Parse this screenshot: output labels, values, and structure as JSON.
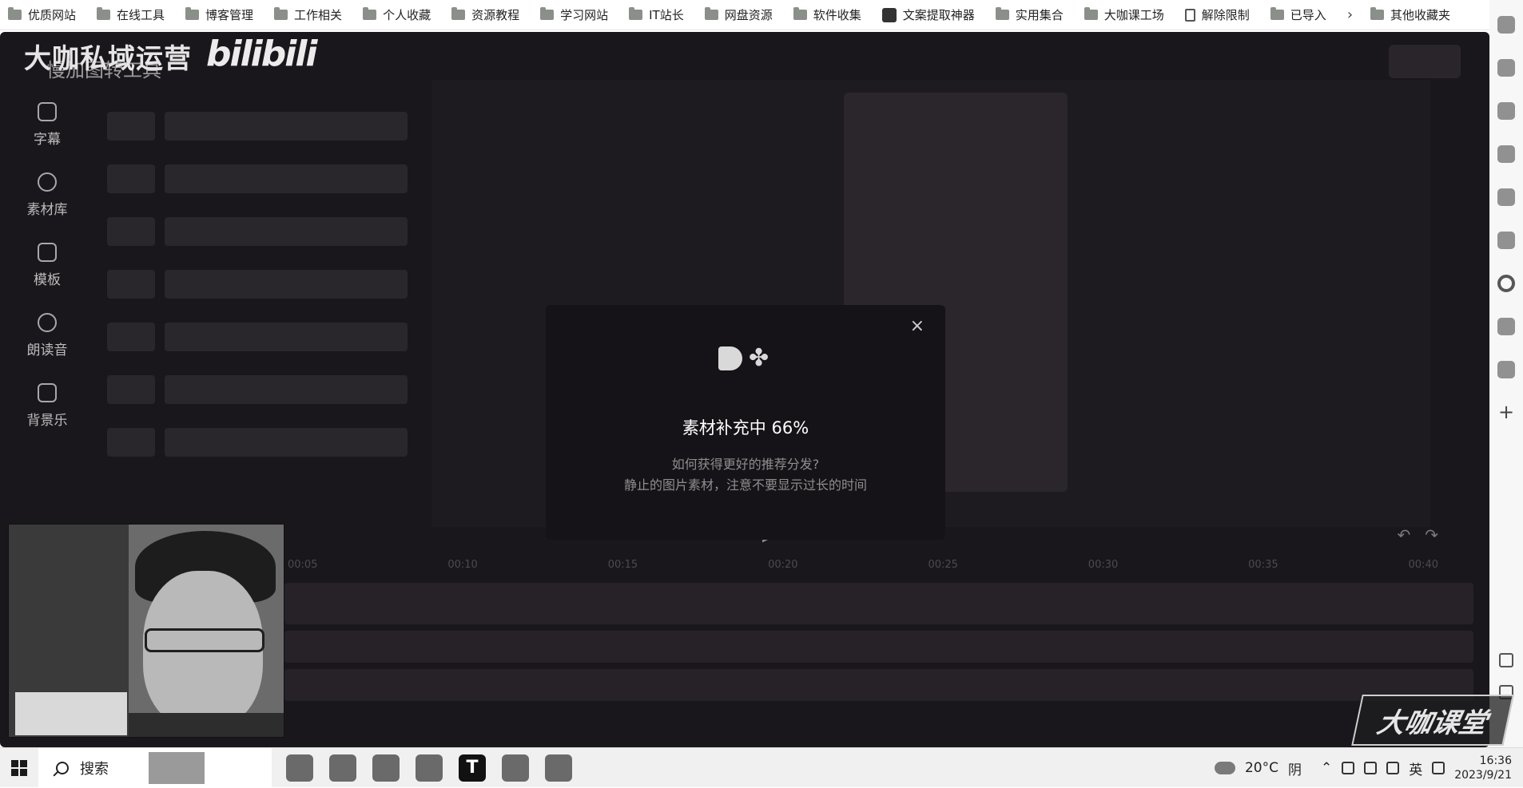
{
  "bookmarks": [
    {
      "label": "优质网站",
      "icon": "folder-icon"
    },
    {
      "label": "在线工具",
      "icon": "folder-icon"
    },
    {
      "label": "博客管理",
      "icon": "folder-icon"
    },
    {
      "label": "工作相关",
      "icon": "folder-icon"
    },
    {
      "label": "个人收藏",
      "icon": "folder-icon"
    },
    {
      "label": "资源教程",
      "icon": "folder-icon"
    },
    {
      "label": "学习网站",
      "icon": "folder-icon"
    },
    {
      "label": "IT站长",
      "icon": "folder-icon"
    },
    {
      "label": "网盘资源",
      "icon": "folder-icon"
    },
    {
      "label": "软件收集",
      "icon": "folder-icon"
    },
    {
      "label": "文案提取神器",
      "icon": "app-icon"
    },
    {
      "label": "实用集合",
      "icon": "folder-icon"
    },
    {
      "label": "大咖课工场",
      "icon": "folder-icon"
    },
    {
      "label": "解除限制",
      "icon": "document-icon"
    },
    {
      "label": "已导入",
      "icon": "folder-icon"
    }
  ],
  "bookmarks_more": "›",
  "bookmarks_other": "其他收藏夹",
  "app": {
    "brand_overlay": "大咖私域运营",
    "subtitle": "慢加图转工具",
    "bili_logo": "bilibili",
    "nav": [
      {
        "label": "字幕",
        "icon": "subtitle-icon"
      },
      {
        "label": "素材库",
        "icon": "layers-icon"
      },
      {
        "label": "模板",
        "icon": "template-icon"
      },
      {
        "label": "朗读音",
        "icon": "voice-icon"
      },
      {
        "label": "背景乐",
        "icon": "music-icon"
      }
    ],
    "player": {
      "prev": "⏮",
      "play": "▶",
      "next": "⏭",
      "undo": "↶",
      "redo": "↷"
    },
    "timeline_ticks": [
      "00:05",
      "00:10",
      "00:15",
      "00:20",
      "00:25",
      "00:30",
      "00:35",
      "00:40"
    ]
  },
  "modal": {
    "close": "×",
    "title": "素材补充中 66%",
    "progress_percent": 66,
    "hint_question": "如何获得更好的推荐分发?",
    "hint_answer": "静止的图片素材，注意不要显示过长的时间"
  },
  "watermark": "大咖课堂",
  "taskbar": {
    "search_label": "搜索",
    "apps": [
      {
        "name": "edge-icon",
        "glyph": ""
      },
      {
        "name": "chrome-icon",
        "glyph": ""
      },
      {
        "name": "notes-icon",
        "glyph": ""
      },
      {
        "name": "image-editor-icon",
        "glyph": ""
      },
      {
        "name": "typora-icon",
        "glyph": "T"
      },
      {
        "name": "file-explorer-icon",
        "glyph": ""
      },
      {
        "name": "flower-app-icon",
        "glyph": ""
      }
    ],
    "weather_temp": "20°C",
    "weather_desc": "阴",
    "ime": "英",
    "time": "16:36",
    "date": "2023/9/21"
  }
}
